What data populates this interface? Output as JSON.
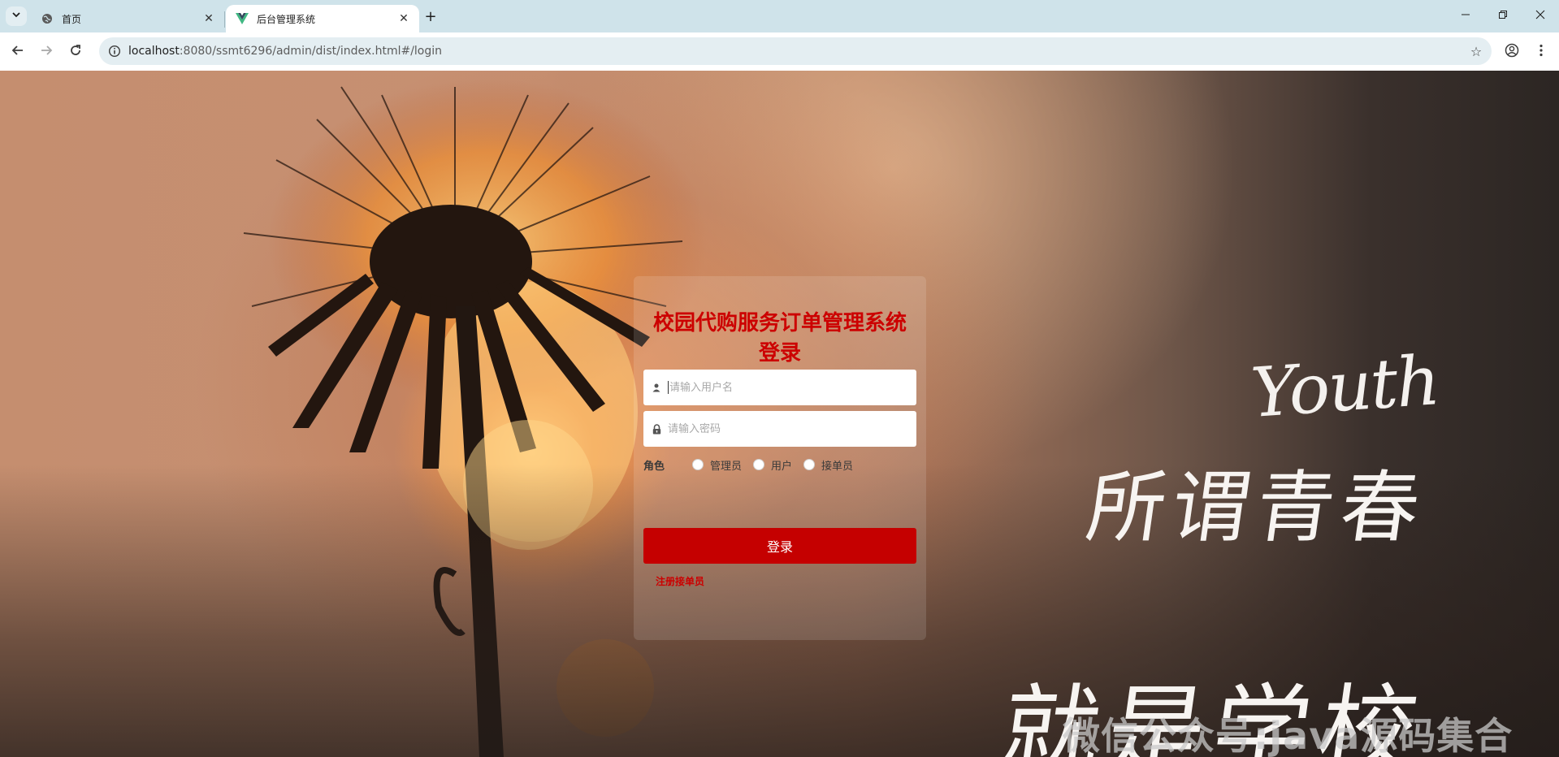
{
  "browser": {
    "tabs": [
      {
        "title": "首页",
        "icon": "globe-icon",
        "active": false
      },
      {
        "title": "后台管理系统",
        "icon": "vue-logo-icon",
        "active": true
      }
    ],
    "url_host": "localhost",
    "url_path": ":8080/ssmt6296/admin/dist/index.html#/login"
  },
  "login": {
    "title": "校园代购服务订单管理系统登录",
    "username_placeholder": "请输入用户名",
    "password_placeholder": "请输入密码",
    "role_label": "角色",
    "roles": [
      "管理员",
      "用户",
      "接单员"
    ],
    "submit_label": "登录",
    "register_label": "注册接单员"
  },
  "background_text": {
    "youth": "Youth",
    "line1": "所谓青春",
    "line2": "就是学校"
  },
  "watermark": "微信公众号:java源码集合",
  "colors": {
    "accent": "#c50000",
    "title": "#cc0000"
  }
}
